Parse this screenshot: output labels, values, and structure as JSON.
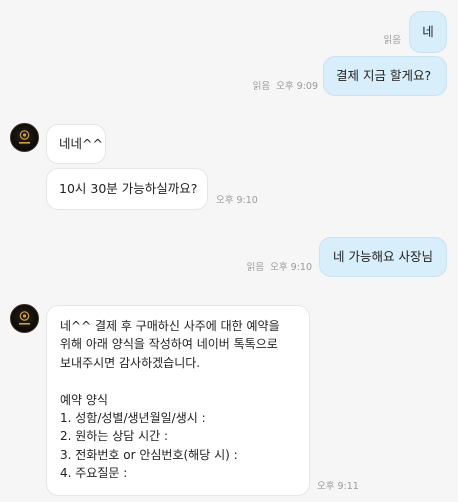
{
  "messages": [
    {
      "text": "네",
      "read": "읽음",
      "time": ""
    },
    {
      "text": "결제 지금 할게요?",
      "read": "읽음",
      "time": "오후 9:09"
    },
    {
      "text": "네네^^",
      "time": ""
    },
    {
      "text": "10시 30분 가능하실까요?",
      "time": "오후 9:10"
    },
    {
      "text": "네 가능해요 사장님",
      "read": "읽음",
      "time": "오후 9:10"
    },
    {
      "lines": [
        "네^^ 결제 후 구매하신 사주에 대한 예약을",
        "위해 아래 양식을 작성하여 네이버 톡톡으로",
        "보내주시면 감사하겠습니다.",
        "",
        "예약 양식",
        "1. 성함/성별/생년월일/생시 :",
        "2. 원하는 상담 시간 :",
        "3. 전화번호 or 안심번호(해당 시) :",
        "4. 주요질문 :"
      ],
      "time": "오후 9:11"
    }
  ],
  "colors": {
    "outgoing_bubble": "#d8eefa",
    "incoming_bubble": "#ffffff",
    "background": "#f6f6f6",
    "meta_text": "#9a9a9a"
  },
  "icons": {
    "avatar": "shop-logo-avatar"
  }
}
